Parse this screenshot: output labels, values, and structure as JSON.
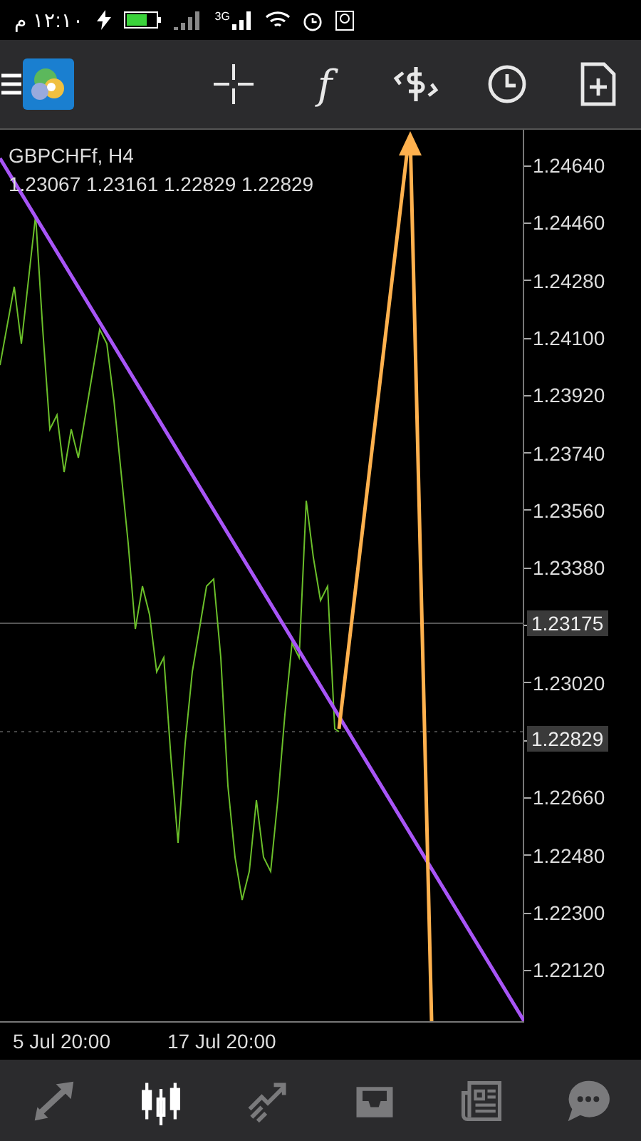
{
  "status_bar": {
    "time": "١٢:١٠ م",
    "network": "3G"
  },
  "toolbar": {
    "function_glyph": "f"
  },
  "chart": {
    "symbol": "GBPCHFf, H4",
    "ohlc": "1.23067 1.23161 1.22829 1.22829",
    "price_axis": [
      {
        "label": "1.24640"
      },
      {
        "label": "1.24460"
      },
      {
        "label": "1.24280"
      },
      {
        "label": "1.24100"
      },
      {
        "label": "1.23920"
      },
      {
        "label": "1.23740"
      },
      {
        "label": "1.23560"
      },
      {
        "label": "1.23380"
      },
      {
        "label": "1.23020"
      },
      {
        "label": "1.22660"
      },
      {
        "label": "1.22480"
      },
      {
        "label": "1.22300"
      },
      {
        "label": "1.22120"
      }
    ],
    "markers": [
      {
        "label": "1.23175"
      },
      {
        "label": "1.22829"
      }
    ],
    "time_axis": [
      "5 Jul 20:00",
      "17 Jul 20:00"
    ]
  },
  "bottom_nav": [
    {
      "kind": "quotes",
      "selected": false
    },
    {
      "kind": "chart",
      "selected": true
    },
    {
      "kind": "trade",
      "selected": false
    },
    {
      "kind": "history",
      "selected": false
    },
    {
      "kind": "news",
      "selected": false
    },
    {
      "kind": "chat",
      "selected": false
    }
  ]
}
